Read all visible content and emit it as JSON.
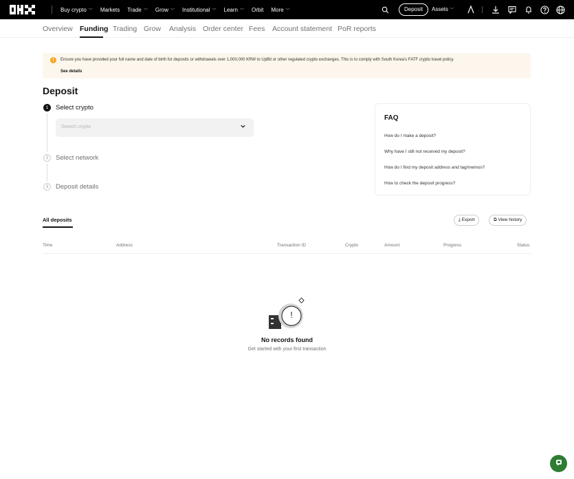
{
  "topnav": {
    "links": [
      {
        "label": "Buy crypto",
        "chevron": true
      },
      {
        "label": "Markets",
        "chevron": false
      },
      {
        "label": "Trade",
        "chevron": true
      },
      {
        "label": "Grow",
        "chevron": true
      },
      {
        "label": "Institutional",
        "chevron": true
      },
      {
        "label": "Learn",
        "chevron": true
      },
      {
        "label": "Orbit",
        "chevron": false
      },
      {
        "label": "More",
        "chevron": true
      }
    ],
    "deposit_label": "Deposit",
    "assets_label": "Assets",
    "chevron_glyph": "﹀",
    "icons": [
      "search-icon",
      "user-icon",
      "download-icon",
      "message-icon",
      "bell-icon",
      "help-icon",
      "globe-icon"
    ]
  },
  "subnav": {
    "tabs": [
      "Overview",
      "Funding",
      "Trading",
      "Grow",
      "Analysis",
      "Order center",
      "Fees",
      "Account statement",
      "PoR reports"
    ],
    "active": "Funding"
  },
  "notice": {
    "icon_glyph": "!",
    "text": "Ensure you have provided your full name and date of birth for deposits or withdrawals over 1,000,000 KRW to UpBit or other regulated crypto exchanges. This is to comply with South Korea's FATF crypto travel policy.",
    "link": "See details"
  },
  "page": {
    "title": "Deposit"
  },
  "steps": [
    {
      "num": "1",
      "label": "Select crypto",
      "active": true
    },
    {
      "num": "2",
      "label": "Select network",
      "active": false
    },
    {
      "num": "3",
      "label": "Deposit details",
      "active": false
    }
  ],
  "search": {
    "placeholder": "Search crypto",
    "chevron_glyph": "⌄"
  },
  "faq": {
    "title": "FAQ",
    "items": [
      "How do I make a deposit?",
      "Why have I still not received my deposit?",
      "How do I find my deposit address and tag/memos?",
      "How to check the deposit progress?"
    ]
  },
  "deposits": {
    "tab_label": "All deposits",
    "export_label": "Export",
    "view_history_label": "View history",
    "export_glyph": "⤓",
    "view_history_glyph": "⧉",
    "columns": [
      "Time",
      "Address",
      "Transaction ID",
      "Crypto",
      "Amount",
      "Progress",
      "Status"
    ],
    "empty_title": "No records found",
    "empty_subtitle": "Get started with your first transaction",
    "empty_glyph": "!"
  },
  "colors": {
    "topbar_bg": "#000000",
    "warning": "#f5a623",
    "notice_bg": "#fdf6ec",
    "support": "#2e7d32"
  }
}
